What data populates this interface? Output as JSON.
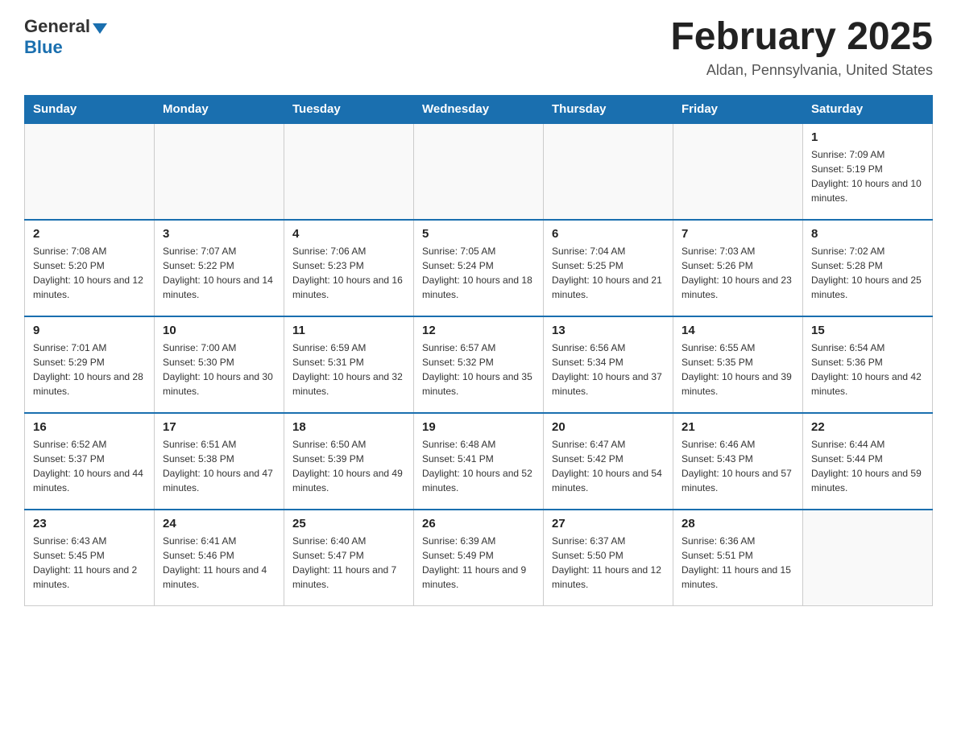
{
  "header": {
    "logo_general": "General",
    "logo_blue": "Blue",
    "month_title": "February 2025",
    "location": "Aldan, Pennsylvania, United States"
  },
  "days_of_week": [
    "Sunday",
    "Monday",
    "Tuesday",
    "Wednesday",
    "Thursday",
    "Friday",
    "Saturday"
  ],
  "weeks": [
    {
      "days": [
        {
          "date": "",
          "info": ""
        },
        {
          "date": "",
          "info": ""
        },
        {
          "date": "",
          "info": ""
        },
        {
          "date": "",
          "info": ""
        },
        {
          "date": "",
          "info": ""
        },
        {
          "date": "",
          "info": ""
        },
        {
          "date": "1",
          "info": "Sunrise: 7:09 AM\nSunset: 5:19 PM\nDaylight: 10 hours and 10 minutes."
        }
      ]
    },
    {
      "days": [
        {
          "date": "2",
          "info": "Sunrise: 7:08 AM\nSunset: 5:20 PM\nDaylight: 10 hours and 12 minutes."
        },
        {
          "date": "3",
          "info": "Sunrise: 7:07 AM\nSunset: 5:22 PM\nDaylight: 10 hours and 14 minutes."
        },
        {
          "date": "4",
          "info": "Sunrise: 7:06 AM\nSunset: 5:23 PM\nDaylight: 10 hours and 16 minutes."
        },
        {
          "date": "5",
          "info": "Sunrise: 7:05 AM\nSunset: 5:24 PM\nDaylight: 10 hours and 18 minutes."
        },
        {
          "date": "6",
          "info": "Sunrise: 7:04 AM\nSunset: 5:25 PM\nDaylight: 10 hours and 21 minutes."
        },
        {
          "date": "7",
          "info": "Sunrise: 7:03 AM\nSunset: 5:26 PM\nDaylight: 10 hours and 23 minutes."
        },
        {
          "date": "8",
          "info": "Sunrise: 7:02 AM\nSunset: 5:28 PM\nDaylight: 10 hours and 25 minutes."
        }
      ]
    },
    {
      "days": [
        {
          "date": "9",
          "info": "Sunrise: 7:01 AM\nSunset: 5:29 PM\nDaylight: 10 hours and 28 minutes."
        },
        {
          "date": "10",
          "info": "Sunrise: 7:00 AM\nSunset: 5:30 PM\nDaylight: 10 hours and 30 minutes."
        },
        {
          "date": "11",
          "info": "Sunrise: 6:59 AM\nSunset: 5:31 PM\nDaylight: 10 hours and 32 minutes."
        },
        {
          "date": "12",
          "info": "Sunrise: 6:57 AM\nSunset: 5:32 PM\nDaylight: 10 hours and 35 minutes."
        },
        {
          "date": "13",
          "info": "Sunrise: 6:56 AM\nSunset: 5:34 PM\nDaylight: 10 hours and 37 minutes."
        },
        {
          "date": "14",
          "info": "Sunrise: 6:55 AM\nSunset: 5:35 PM\nDaylight: 10 hours and 39 minutes."
        },
        {
          "date": "15",
          "info": "Sunrise: 6:54 AM\nSunset: 5:36 PM\nDaylight: 10 hours and 42 minutes."
        }
      ]
    },
    {
      "days": [
        {
          "date": "16",
          "info": "Sunrise: 6:52 AM\nSunset: 5:37 PM\nDaylight: 10 hours and 44 minutes."
        },
        {
          "date": "17",
          "info": "Sunrise: 6:51 AM\nSunset: 5:38 PM\nDaylight: 10 hours and 47 minutes."
        },
        {
          "date": "18",
          "info": "Sunrise: 6:50 AM\nSunset: 5:39 PM\nDaylight: 10 hours and 49 minutes."
        },
        {
          "date": "19",
          "info": "Sunrise: 6:48 AM\nSunset: 5:41 PM\nDaylight: 10 hours and 52 minutes."
        },
        {
          "date": "20",
          "info": "Sunrise: 6:47 AM\nSunset: 5:42 PM\nDaylight: 10 hours and 54 minutes."
        },
        {
          "date": "21",
          "info": "Sunrise: 6:46 AM\nSunset: 5:43 PM\nDaylight: 10 hours and 57 minutes."
        },
        {
          "date": "22",
          "info": "Sunrise: 6:44 AM\nSunset: 5:44 PM\nDaylight: 10 hours and 59 minutes."
        }
      ]
    },
    {
      "days": [
        {
          "date": "23",
          "info": "Sunrise: 6:43 AM\nSunset: 5:45 PM\nDaylight: 11 hours and 2 minutes."
        },
        {
          "date": "24",
          "info": "Sunrise: 6:41 AM\nSunset: 5:46 PM\nDaylight: 11 hours and 4 minutes."
        },
        {
          "date": "25",
          "info": "Sunrise: 6:40 AM\nSunset: 5:47 PM\nDaylight: 11 hours and 7 minutes."
        },
        {
          "date": "26",
          "info": "Sunrise: 6:39 AM\nSunset: 5:49 PM\nDaylight: 11 hours and 9 minutes."
        },
        {
          "date": "27",
          "info": "Sunrise: 6:37 AM\nSunset: 5:50 PM\nDaylight: 11 hours and 12 minutes."
        },
        {
          "date": "28",
          "info": "Sunrise: 6:36 AM\nSunset: 5:51 PM\nDaylight: 11 hours and 15 minutes."
        },
        {
          "date": "",
          "info": ""
        }
      ]
    }
  ]
}
